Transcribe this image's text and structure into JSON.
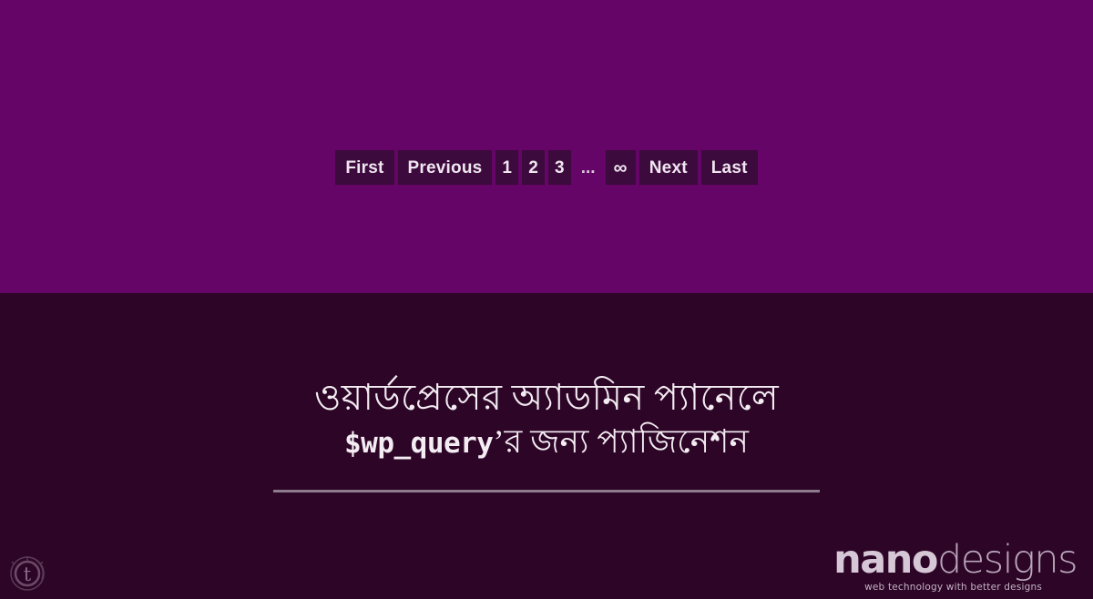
{
  "theme": {
    "top_background": "#650567",
    "bottom_background": "#2d0527",
    "button_background": "#3d0a3d",
    "button_text": "#efe6ef",
    "headline_text": "#f3ecf2",
    "divider_color": "#8d7a8d",
    "brand_primary": "#d6c7d6",
    "brand_secondary": "#b9a6ba"
  },
  "pagination": {
    "items": [
      {
        "label": "First",
        "kind": "word"
      },
      {
        "label": "Previous",
        "kind": "word"
      },
      {
        "label": "1",
        "kind": "num"
      },
      {
        "label": "2",
        "kind": "num"
      },
      {
        "label": "3",
        "kind": "num"
      },
      {
        "label": "...",
        "kind": "gap"
      },
      {
        "label": "∞",
        "kind": "inf"
      },
      {
        "label": "Next",
        "kind": "word"
      },
      {
        "label": "Last",
        "kind": "word"
      }
    ],
    "first_label": "First",
    "previous_label": "Previous",
    "page_1_label": "1",
    "page_2_label": "2",
    "page_3_label": "3",
    "gap_label": "...",
    "infinity_label": "∞",
    "next_label": "Next",
    "last_label": "Last"
  },
  "headline": {
    "line1": "ওয়ার্ডপ্রেসের অ্যাডমিন প্যানেলে",
    "line2_code": "$wp_query",
    "line2_rest": "’র জন্য প্যাজিনেশন"
  },
  "brand": {
    "name_bold": "nano",
    "name_light": "designs",
    "tagline": "web technology with better designs"
  },
  "badge": {
    "letter": "t"
  }
}
